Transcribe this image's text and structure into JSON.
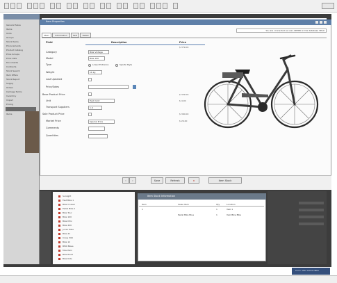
{
  "toolbar": {
    "icons": [
      "file-icon",
      "save-icon",
      "print-icon",
      "cut-icon",
      "copy-icon",
      "paste-icon",
      "undo-icon",
      "redo-icon",
      "search-icon",
      "settings-icon"
    ]
  },
  "outer": {
    "nav_items": [
      "General Sales",
      "Items",
      "Units",
      "Groups",
      "Stock Items",
      "Procurements",
      "Product Catalog",
      "Price Groups",
      "Price Lists",
      "Documents",
      "Contracts",
      "Stock Search",
      "Item Offers",
      "Stock Report",
      "Supply",
      "Orders",
      "Carriage Terms",
      "Inventory",
      "Import",
      "Pricing",
      "Items"
    ]
  },
  "window": {
    "title": "Item Properties",
    "info": "You are connected as user ADMIN on the database VELO",
    "tabs": [
      "Main",
      "Information",
      "Text",
      "Detail"
    ],
    "headers": {
      "field": "Field",
      "description": "Description",
      "price": "Price"
    },
    "fields": [
      {
        "label": "Category",
        "value": "Bike Vintage"
      },
      {
        "label": "Model",
        "value": "Bike 100"
      },
      {
        "label": "Type",
        "value": ""
      },
      {
        "label": "Weight",
        "value": "16 kg"
      },
      {
        "label": "Last Updated",
        "value": "1"
      },
      {
        "label": "Price/Sales",
        "value": ""
      },
      {
        "label": "Base Product Price",
        "value": "10"
      },
      {
        "label": "Unit",
        "value": "Each Unit"
      },
      {
        "label": "Transport Suppliers",
        "value": "1.4"
      },
      {
        "label": "Sale Product Price",
        "value": "10"
      },
      {
        "label": "Market Price",
        "value": "Special Price"
      },
      {
        "label": "Comments",
        "value": ""
      },
      {
        "label": "Quantities",
        "value": ""
      }
    ],
    "type_options": {
      "first": "Lower Entrance",
      "second": "Sports Style"
    },
    "prices": [
      "$ 379.00",
      "$ 329.00",
      "$ 4.00",
      "$ 390.00",
      "$ 26.00"
    ],
    "buttons": {
      "prev": "‹",
      "next": "›",
      "save": "Save",
      "refresh": "Refresh",
      "close": "×",
      "item_stock": "Item Stock"
    }
  },
  "tree": {
    "items": [
      "Sunlight",
      "Fast Bike 1",
      "Bike Cruiser",
      "Pedal Bike 1",
      "Bike Tour",
      "Bike 100",
      "Bike Mini",
      "Bike 200",
      "Junior Bike",
      "Bike 21",
      "Cross 300",
      "Bike 12",
      "BMX Bikes",
      "Mountain",
      "Bike Road",
      "Bike Kids"
    ]
  },
  "subwin": {
    "title": "Item Stock Information",
    "columns": [
      "Item",
      "Sales Item",
      "Qty",
      "Location"
    ],
    "rows": [
      {
        "a": "1",
        "b": "",
        "c": "1",
        "d": "Velo 1"
      },
      {
        "a": "",
        "b": "Pedal Bike Blue",
        "c": "1",
        "d": "Velo Bike Bike"
      }
    ]
  },
  "status": {
    "text": "Conn. Velo Admin Bike"
  }
}
